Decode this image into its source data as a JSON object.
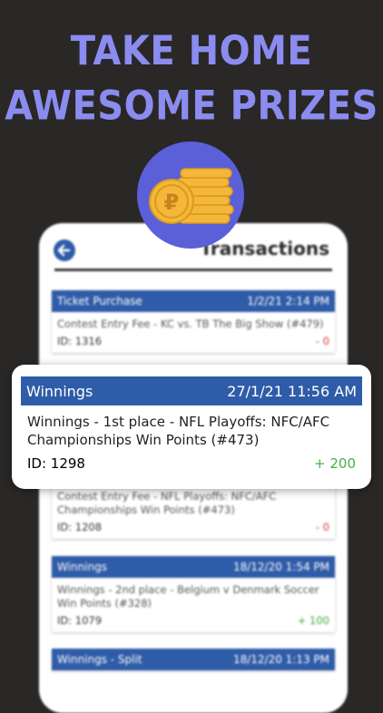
{
  "headline": {
    "line1": "TAKE HOME",
    "line2": "AWESOME PRIZES"
  },
  "icon": {
    "name": "coin-stack-icon",
    "symbol": "₽"
  },
  "screen": {
    "title": "Transactions",
    "transactions": [
      {
        "type": "Ticket Purchase",
        "date": "1/2/21 2:14 PM",
        "description": "Contest Entry Fee - KC vs. TB The Big Show (#479)",
        "id": "ID: 1316",
        "amount": "- 0"
      },
      {
        "type": "",
        "date": "",
        "description": "Contest Entry Fee - NFL Playoffs: NFC/AFC Championships Win Points (#473)",
        "id": "ID: 1208",
        "amount": "- 0"
      },
      {
        "type": "Winnings",
        "date": "18/12/20 1:54 PM",
        "description": "Winnings - 2nd place - Belgium v Denmark Soccer Win Points (#328)",
        "id": "ID: 1079",
        "amount": "+ 100"
      },
      {
        "type": "Winnings - Split",
        "date": "18/12/20 1:13 PM"
      }
    ]
  },
  "highlight": {
    "type": "Winnings",
    "date": "27/1/21 11:56 AM",
    "description": "Winnings - 1st place - NFL Playoffs: NFC/AFC Championships Win Points (#473)",
    "id": "ID: 1298",
    "amount": "+ 200"
  },
  "colors": {
    "background": "#2a2727",
    "headline": "#8b8cf0",
    "accent": "#2f5ca8",
    "positive": "#44b044",
    "negative": "#d33333",
    "coin_bg": "#5b5fd8",
    "coin": "#f4b73a"
  }
}
